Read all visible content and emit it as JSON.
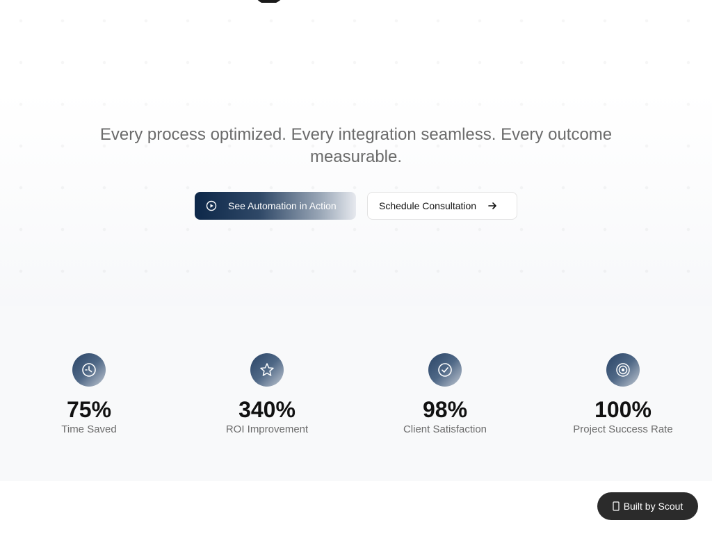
{
  "hero": {
    "tagline": "Every process optimized. Every integration seamless. Every outcome measurable.",
    "primary_button": {
      "label": "See Automation in Action",
      "icon": "play-circle-icon"
    },
    "secondary_button": {
      "label": "Schedule Consultation",
      "icon": "arrow-right-icon"
    }
  },
  "stats": [
    {
      "value": "75%",
      "label": "Time Saved",
      "icon": "clock-icon"
    },
    {
      "value": "340%",
      "label": "ROI Improvement",
      "icon": "star-icon"
    },
    {
      "value": "98%",
      "label": "Client Satisfaction",
      "icon": "check-circle-icon"
    },
    {
      "value": "100%",
      "label": "Project Success Rate",
      "icon": "target-icon"
    }
  ],
  "badge": {
    "label": "Built by Scout",
    "icon": "scout-icon"
  },
  "colors": {
    "primary_dark": "#0d2849",
    "stats_background": "#f8f9fa",
    "badge_background": "#2b2b2b",
    "muted_text": "#6b6b6b"
  }
}
